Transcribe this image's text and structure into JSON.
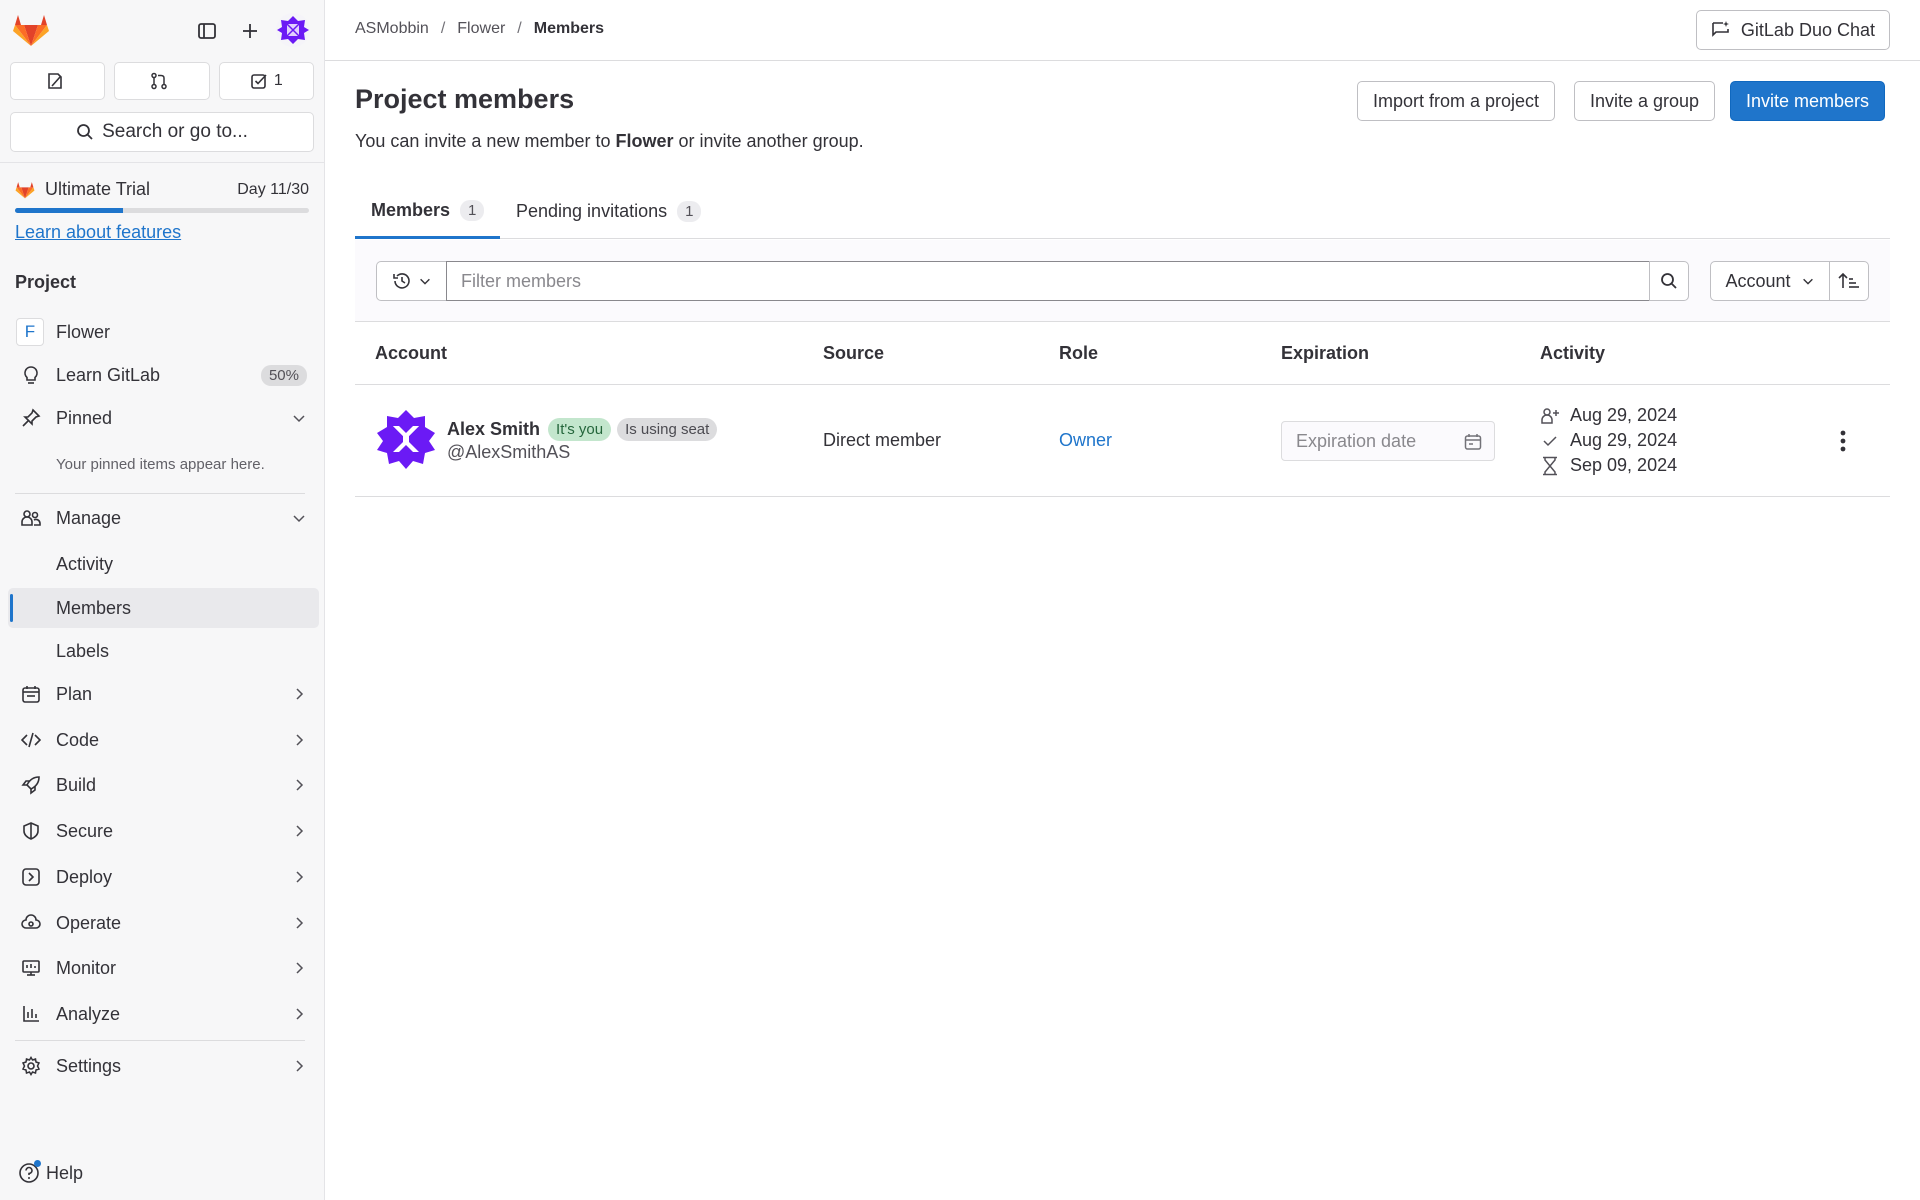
{
  "sidebar": {
    "counts": {
      "issues": "",
      "merge_requests": "",
      "todos": "1"
    },
    "search_label": "Search or go to...",
    "trial": {
      "name": "Ultimate Trial",
      "day": "Day 11/30",
      "progress": 0.367,
      "learn_link": "Learn about features"
    },
    "section_label": "Project",
    "project_tile": "F",
    "project_name": "Flower",
    "learn_gitlab": {
      "label": "Learn GitLab",
      "badge": "50%"
    },
    "pinned": {
      "label": "Pinned",
      "note": "Your pinned items appear here."
    },
    "manage": {
      "label": "Manage",
      "items": [
        "Activity",
        "Members",
        "Labels"
      ]
    },
    "groups": [
      "Plan",
      "Code",
      "Build",
      "Secure",
      "Deploy",
      "Operate",
      "Monitor",
      "Analyze"
    ],
    "settings": "Settings",
    "help": "Help"
  },
  "breadcrumb": [
    "ASMobbin",
    "Flower",
    "Members"
  ],
  "duo_chat": "GitLab Duo Chat",
  "page": {
    "title": "Project members",
    "desc_prefix": "You can invite a new member to ",
    "desc_project": "Flower",
    "desc_suffix": " or invite another group.",
    "buttons": {
      "import": "Import from a project",
      "invite_group": "Invite a group",
      "invite_members": "Invite members"
    }
  },
  "tabs": [
    {
      "label": "Members",
      "count": "1"
    },
    {
      "label": "Pending invitations",
      "count": "1"
    }
  ],
  "filter": {
    "placeholder": "Filter members",
    "sort_label": "Account"
  },
  "table": {
    "headers": [
      "Account",
      "Source",
      "Role",
      "Expiration",
      "Activity"
    ],
    "rows": [
      {
        "name": "Alex Smith",
        "badges": [
          "It's you",
          "Is using seat"
        ],
        "username": "@AlexSmithAS",
        "source": "Direct member",
        "role": "Owner",
        "expiration_placeholder": "Expiration date",
        "activity": [
          "Aug 29, 2024",
          "Aug 29, 2024",
          "Sep 09, 2024"
        ]
      }
    ]
  },
  "colors": {
    "accent": "#1f75cb",
    "brand_orange": "#e24329",
    "avatar_purple": "#6b1af5"
  }
}
